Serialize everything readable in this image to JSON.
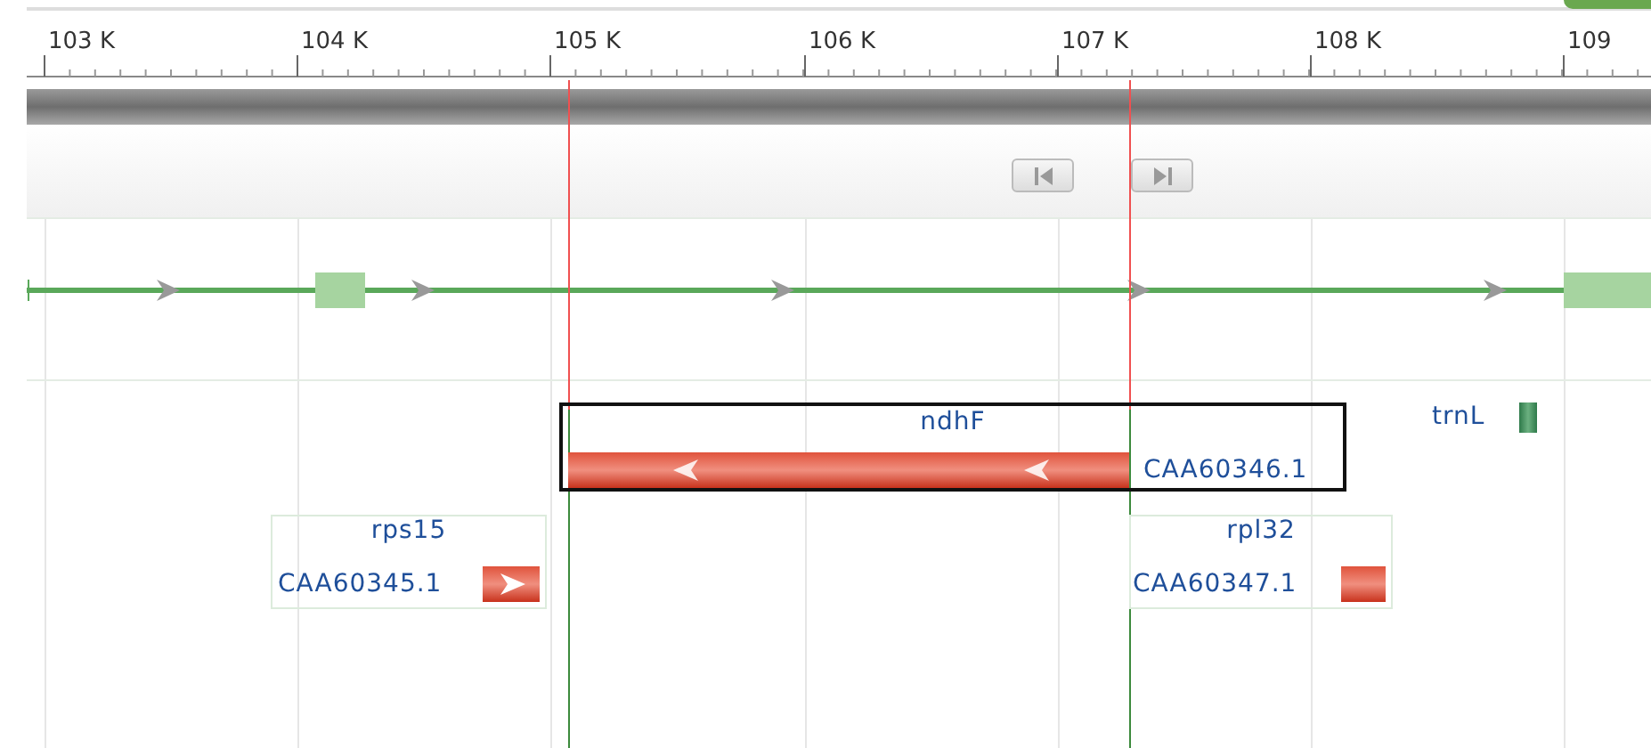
{
  "ruler": {
    "ticks": [
      "103 K",
      "104 K",
      "105 K",
      "106 K",
      "107 K",
      "108 K",
      "109"
    ]
  },
  "navigation": {
    "buttons": [
      {
        "kind": "previous"
      },
      {
        "kind": "next"
      }
    ]
  },
  "features": [
    {
      "kind": "cds",
      "gene": "ndhF",
      "protein": "CAA60346.1",
      "arrows": true,
      "reverse": true,
      "selected": true
    },
    {
      "kind": "trna",
      "gene": "trnL",
      "selected": false
    },
    {
      "kind": "cds",
      "gene": "rps15",
      "protein": "CAA60345.1",
      "arrows": true,
      "reverse": false,
      "selected": false
    },
    {
      "kind": "cds",
      "gene": "rpl32",
      "protein": "CAA60347.1",
      "arrows": false,
      "selected": false
    }
  ]
}
